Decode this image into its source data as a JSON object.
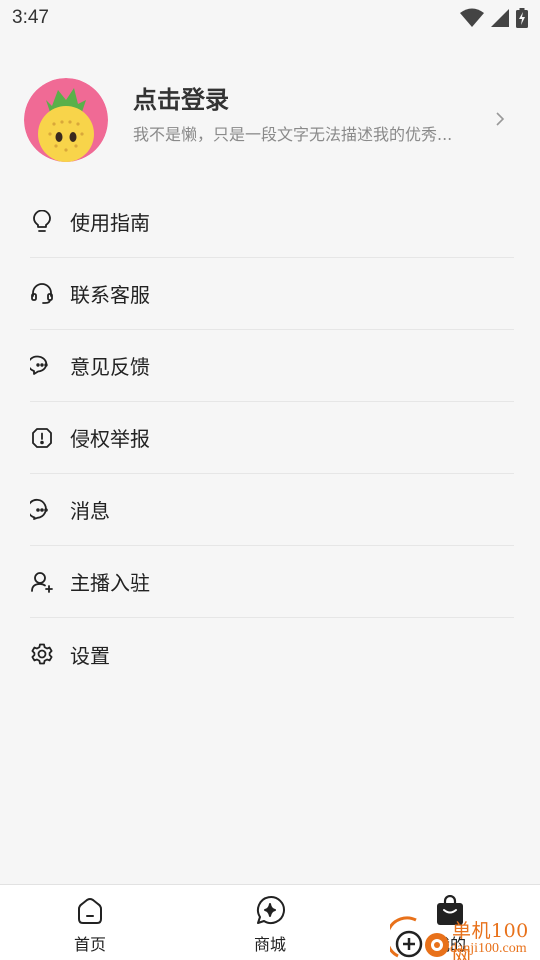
{
  "status_bar": {
    "time": "3:47",
    "icons": [
      "wifi-icon",
      "cell-signal-icon",
      "battery-charging-icon"
    ]
  },
  "profile": {
    "name": "点击登录",
    "description": "我不是懒，只是一段文字无法描述我的优秀...",
    "avatar": "pineapple-avatar"
  },
  "menu": {
    "items": [
      {
        "label": "使用指南",
        "icon": "lightbulb-icon"
      },
      {
        "label": "联系客服",
        "icon": "headset-icon"
      },
      {
        "label": "意见反馈",
        "icon": "chat-bubbles-icon"
      },
      {
        "label": "侵权举报",
        "icon": "alert-icon"
      },
      {
        "label": "消息",
        "icon": "message-icon"
      },
      {
        "label": "主播入驻",
        "icon": "user-add-icon"
      },
      {
        "label": "设置",
        "icon": "gear-icon"
      }
    ]
  },
  "tab_bar": {
    "items": [
      {
        "label": "首页",
        "icon": "home-icon"
      },
      {
        "label": "商城",
        "icon": "sparkle-bubble-icon"
      },
      {
        "label": "我的",
        "icon": "shopping-bag-icon"
      }
    ]
  },
  "watermark": {
    "title": "单机100网",
    "url": "danji100.com"
  },
  "colors": {
    "background": "#f6f6f6",
    "watermark": "#e8711a",
    "avatar_bg": "#f06a95",
    "avatar_fruit": "#f8d44a"
  }
}
